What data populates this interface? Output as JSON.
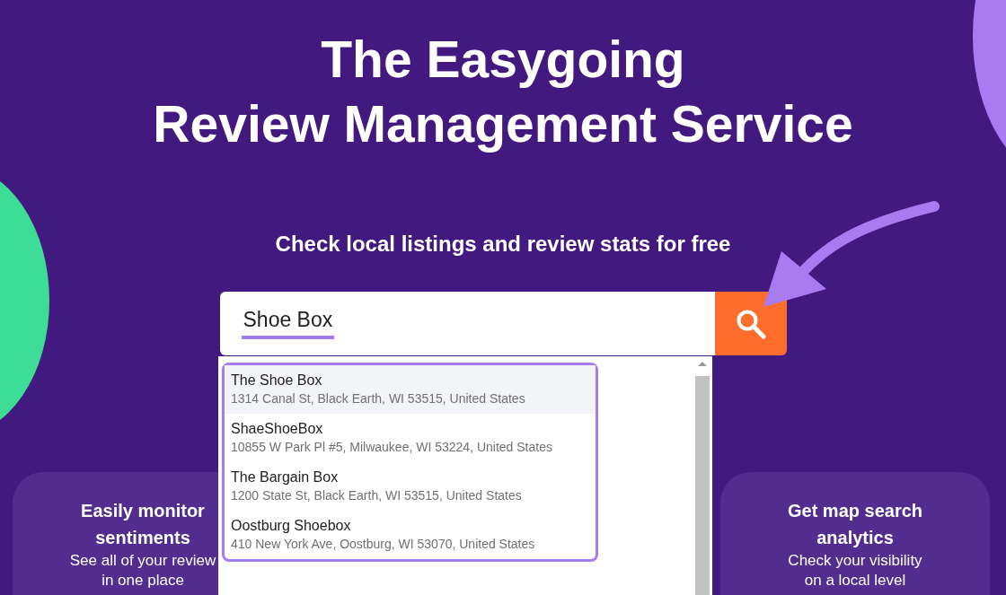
{
  "hero": {
    "title_lines": [
      "The Easygoing",
      "Review Management Service"
    ],
    "subtitle": "Check local listings and review stats for free"
  },
  "search": {
    "value": "Shoe Box"
  },
  "suggestions": [
    {
      "name": "The Shoe Box",
      "address": "1314 Canal St, Black Earth, WI 53515, United States",
      "selected": true
    },
    {
      "name": "ShaeShoeBox",
      "address": "10855 W Park Pl #5, Milwaukee, WI 53224, United States",
      "selected": false
    },
    {
      "name": "The Bargain Box",
      "address": "1200 State St, Black Earth, WI 53515, United States",
      "selected": false
    },
    {
      "name": "Oostburg Shoebox",
      "address": "410 New York Ave, Oostburg, WI 53070, United States",
      "selected": false
    }
  ],
  "features": [
    {
      "title": "Easily monitor sentiments",
      "lines": [
        "See all of your review",
        "in one place"
      ]
    },
    {
      "title": "Get map search analytics",
      "lines": [
        "Check your visibility",
        "on a local level"
      ]
    }
  ]
}
